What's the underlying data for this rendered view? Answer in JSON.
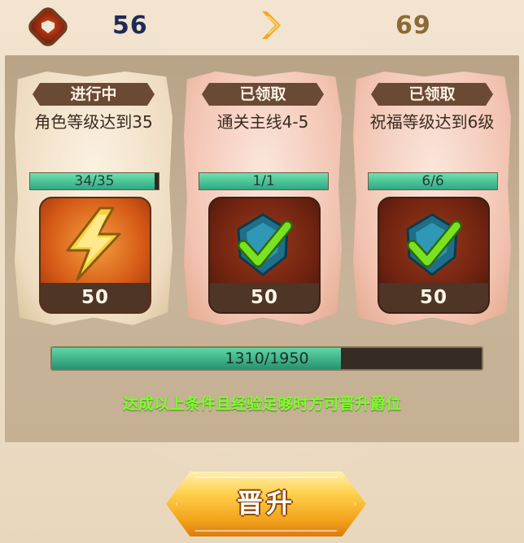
{
  "top": {
    "current_rank_value": "56",
    "next_rank_value": "69",
    "rank_icon": "shield-badge-icon",
    "arrow_icon": "chevron-right-icon"
  },
  "tasks": [
    {
      "status": "进行中",
      "condition": "角色等级达到35",
      "progress_text": "34/35",
      "progress": 0.971,
      "reward_amount": "50",
      "reward_icon": "lightning-icon"
    },
    {
      "status": "已领取",
      "condition": "通关主线4-5",
      "progress_text": "1/1",
      "progress": 1.0,
      "reward_amount": "50",
      "reward_icon": "gem-check-icon"
    },
    {
      "status": "已领取",
      "condition": "祝福等级达到6级",
      "progress_text": "6/6",
      "progress": 1.0,
      "reward_amount": "50",
      "reward_icon": "gem-check-icon"
    }
  ],
  "experience": {
    "text": "1310/1950",
    "current": 1310,
    "max": 1950
  },
  "hint": "达成以上条件且经验足够时方可晋升爵位",
  "promote_button": {
    "label": "晋升"
  },
  "colors": {
    "progress_fill": "#2fa882",
    "hint_text": "#7dff2a",
    "button": "#f3a21b"
  }
}
